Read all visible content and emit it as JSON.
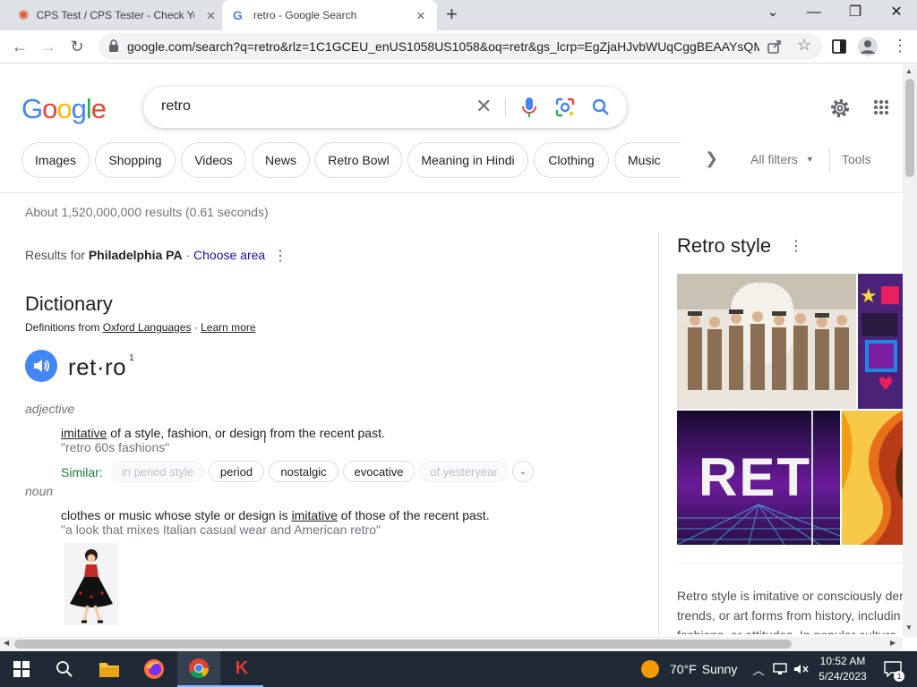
{
  "browser": {
    "tabs": [
      {
        "title": "CPS Test / CPS Tester - Check Yo",
        "close": "×"
      },
      {
        "title": "retro - Google Search",
        "close": "×"
      }
    ],
    "new_tab": "+",
    "window_controls": {
      "dropdown": "⌄",
      "minimize": "—",
      "restore": "❐",
      "close": "✕"
    },
    "url": "google.com/search?q=retro&rlz=1C1GCEU_enUS1058US1058&oq=retr&gs_lcrp=EgZjaHJvbWUqCggBEAAYsQM..."
  },
  "google": {
    "logo_letters": [
      {
        "ch": "G",
        "color": "#4285f4"
      },
      {
        "ch": "o",
        "color": "#ea4335"
      },
      {
        "ch": "o",
        "color": "#fbbc05"
      },
      {
        "ch": "g",
        "color": "#4285f4"
      },
      {
        "ch": "l",
        "color": "#34a853"
      },
      {
        "ch": "e",
        "color": "#ea4335"
      }
    ],
    "query": "retro",
    "chips": [
      "Images",
      "Shopping",
      "Videos",
      "News",
      "Retro Bowl",
      "Meaning in Hindi",
      "Clothing",
      "Music"
    ],
    "all_filters": "All filters",
    "tools": "Tools",
    "stats": "About 1,520,000,000 results (0.61 seconds)",
    "location": {
      "prefix": "Results for ",
      "place": "Philadelphia PA",
      "sep": " · ",
      "choose": "Choose area"
    }
  },
  "dictionary": {
    "title": "Dictionary",
    "defs_prefix": "Definitions from ",
    "source": "Oxford Languages",
    "sep": " · ",
    "learn_more": "Learn more",
    "headword": "ret·ro",
    "sense_number": "1",
    "adjective": {
      "pos": "adjective",
      "def_link": "imitative",
      "def_rest": " of a style, fashion, or design from the recent past.",
      "example": "\"retro 60s fashions\"",
      "similar_label": "Similar:",
      "similar": [
        {
          "word": "in period style",
          "faded": true
        },
        {
          "word": "period",
          "faded": false
        },
        {
          "word": "nostalgic",
          "faded": false
        },
        {
          "word": "evocative",
          "faded": false
        },
        {
          "word": "of yesteryear",
          "faded": true
        }
      ]
    },
    "noun": {
      "pos": "noun",
      "def_start": "clothes or music whose style or design is ",
      "def_link": "imitative",
      "def_rest": " of those of the recent past.",
      "example": "\"a look that mixes Italian casual wear and American retro\""
    }
  },
  "knowledge_panel": {
    "title": "Retro style",
    "image_text": "RET",
    "desc_lines": [
      "Retro style is imitative or consciously der",
      "trends, or art forms from history, includin",
      "fashions, or attitudes. In popular culture"
    ]
  },
  "taskbar": {
    "weather_temp": "70°F",
    "weather_cond": "Sunny",
    "time": "10:52 AM",
    "date": "5/24/2023",
    "notification_count": "1"
  },
  "colors": {
    "link": "#1a0dab",
    "google_blue": "#4285f4",
    "taskbar": "#1f2a36",
    "tab_strip": "#dee1e6"
  }
}
